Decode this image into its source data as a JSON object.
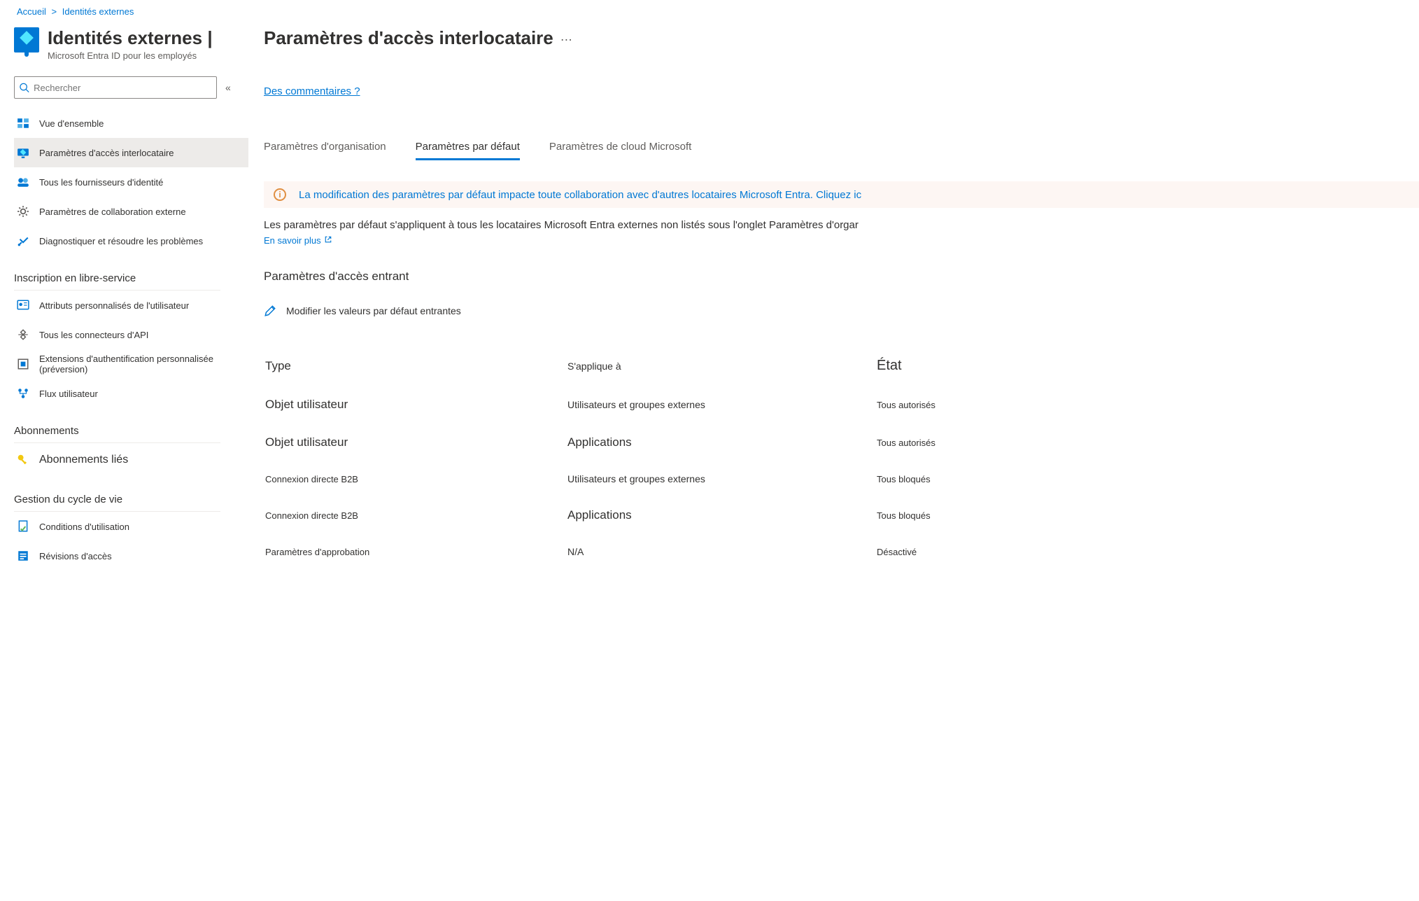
{
  "breadcrumb": {
    "home": "Accueil",
    "sep": ">",
    "page": "Identités externes"
  },
  "blade": {
    "title": "Identités externes |",
    "subtitle": "Microsoft Entra ID pour les employés"
  },
  "search": {
    "placeholder": "Rechercher",
    "collapse_glyph": "«"
  },
  "sidebar": {
    "items": [
      {
        "label": "Vue d'ensemble",
        "icon": "overview-icon",
        "active": false
      },
      {
        "label": "Paramètres d'accès interlocataire",
        "icon": "cross-tenant-icon",
        "active": true
      },
      {
        "label": "Tous les fournisseurs d'identité",
        "icon": "identity-providers-icon",
        "active": false
      },
      {
        "label": "Paramètres de collaboration externe",
        "icon": "gear-icon",
        "active": false
      },
      {
        "label": "Diagnostiquer et résoudre les problèmes",
        "icon": "diagnose-icon",
        "active": false
      }
    ],
    "section_selfservice": {
      "title": "Inscription en libre-service",
      "items": [
        {
          "label": "Attributs personnalisés de l'utilisateur",
          "icon": "user-attr-icon"
        },
        {
          "label": "Tous les connecteurs d'API",
          "icon": "api-connector-icon"
        },
        {
          "label": "Extensions d'authentification personnalisée (préversion)",
          "icon": "auth-ext-icon"
        },
        {
          "label": "Flux utilisateur",
          "icon": "user-flow-icon"
        }
      ]
    },
    "section_subs": {
      "title": "Abonnements",
      "items": [
        {
          "label": "Abonnements liés",
          "icon": "key-icon"
        }
      ]
    },
    "section_lifecycle": {
      "title": "Gestion du cycle de vie",
      "items": [
        {
          "label": "Conditions d'utilisation",
          "icon": "terms-icon"
        },
        {
          "label": "Révisions d'accès",
          "icon": "access-review-icon"
        }
      ]
    }
  },
  "main": {
    "title": "Paramètres d'accès interlocataire",
    "comments": "Des commentaires ?",
    "tabs": [
      {
        "label": "Paramètres d'organisation",
        "active": false
      },
      {
        "label": "Paramètres par défaut",
        "active": true
      },
      {
        "label": "Paramètres de cloud Microsoft",
        "active": false
      }
    ],
    "banner": "La modification des paramètres par défaut impacte toute collaboration avec d'autres locataires Microsoft Entra. Cliquez ic",
    "body": "Les paramètres par défaut s'appliquent à tous les locataires Microsoft Entra externes non listés sous l'onglet Paramètres d'orgar",
    "learn_more": "En savoir plus",
    "section_heading": "Paramètres d'accès entrant",
    "edit_label": "Modifier les valeurs par défaut entrantes",
    "table": {
      "headers": {
        "type": "Type",
        "applies": "S'applique à",
        "state": "État"
      },
      "rows": [
        {
          "type": "Objet utilisateur",
          "applies": "Utilisateurs et groupes externes",
          "state": "Tous autorisés",
          "type_big": true,
          "applies_big": false
        },
        {
          "type": "Objet utilisateur",
          "applies": "Applications",
          "state": "Tous autorisés",
          "type_big": true,
          "applies_big": true
        },
        {
          "type": "Connexion directe B2B",
          "applies": "Utilisateurs et groupes externes",
          "state": "Tous bloqués",
          "type_big": false,
          "applies_big": false
        },
        {
          "type": "Connexion directe B2B",
          "applies": "Applications",
          "state": "Tous bloqués",
          "type_big": false,
          "applies_big": true
        },
        {
          "type": "Paramètres d'approbation",
          "applies": "N/A",
          "state": "Désactivé",
          "type_big": false,
          "applies_big": false
        }
      ]
    }
  }
}
